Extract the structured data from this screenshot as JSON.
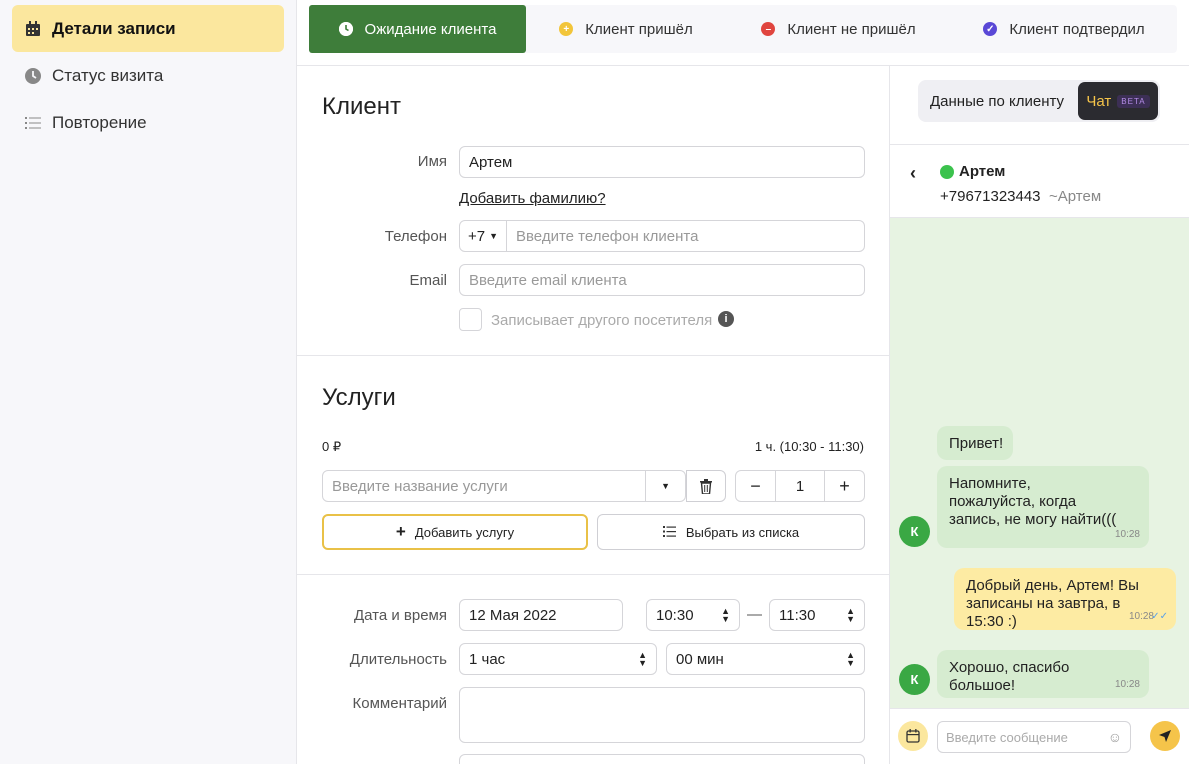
{
  "sidebar": {
    "items": [
      {
        "label": "Детали записи",
        "icon": "calendar-icon",
        "active": true
      },
      {
        "label": "Статус визита",
        "icon": "clock-icon",
        "active": false
      },
      {
        "label": "Повторение",
        "icon": "list-icon",
        "active": false
      }
    ]
  },
  "tabs": [
    {
      "label": "Ожидание клиента",
      "icon": "clock-icon",
      "color": "#ffffff",
      "active": true
    },
    {
      "label": "Клиент пришёл",
      "icon": "plus-circle-icon",
      "color": "#f2c53a",
      "active": false
    },
    {
      "label": "Клиент не пришёл",
      "icon": "minus-circle-icon",
      "color": "#e0453f",
      "active": false
    },
    {
      "label": "Клиент подтвердил",
      "icon": "check-circle-icon",
      "color": "#5a48d6",
      "active": false
    }
  ],
  "client": {
    "title": "Клиент",
    "name_label": "Имя",
    "name_value": "Артем",
    "add_surname": "Добавить фамилию?",
    "phone_label": "Телефон",
    "phone_code": "+7",
    "phone_placeholder": "Введите телефон клиента",
    "email_label": "Email",
    "email_placeholder": "Введите email клиента",
    "other_visitor": "Записывает другого посетителя"
  },
  "services": {
    "title": "Услуги",
    "price": "0 ₽",
    "duration_summary": "1 ч. (10:30 - 11:30)",
    "service_placeholder": "Введите название услуги",
    "quantity": "1",
    "add_service": "Добавить услугу",
    "choose_from_list": "Выбрать из списка"
  },
  "schedule": {
    "datetime_label": "Дата и время",
    "date": "12 Мая 2022",
    "start_time": "10:30",
    "dash": "—",
    "end_time": "11:30",
    "duration_label": "Длительность",
    "hours": "1 час",
    "minutes": "00 мин",
    "comment_label": "Комментарий"
  },
  "chat": {
    "toggle_client_data": "Данные по клиенту",
    "toggle_chat": "Чат",
    "beta": "BETA",
    "contact_name": "Артем",
    "contact_phone": "+79671323443",
    "contact_alias": "~Артем",
    "avatar_letter": "К",
    "messages": [
      {
        "dir": "in",
        "text": "Привет!",
        "time": ""
      },
      {
        "dir": "in",
        "text": "Напомните, пожалуйста, когда запись, не могу найти(((",
        "time": "10:28"
      },
      {
        "dir": "out",
        "text": "Добрый день, Артем! Вы записаны на завтра, в 15:30 :)",
        "time": "10:28"
      },
      {
        "dir": "in",
        "text": "Хорошо, спасибо большое!",
        "time": "10:28"
      }
    ],
    "input_placeholder": "Введите сообщение"
  }
}
